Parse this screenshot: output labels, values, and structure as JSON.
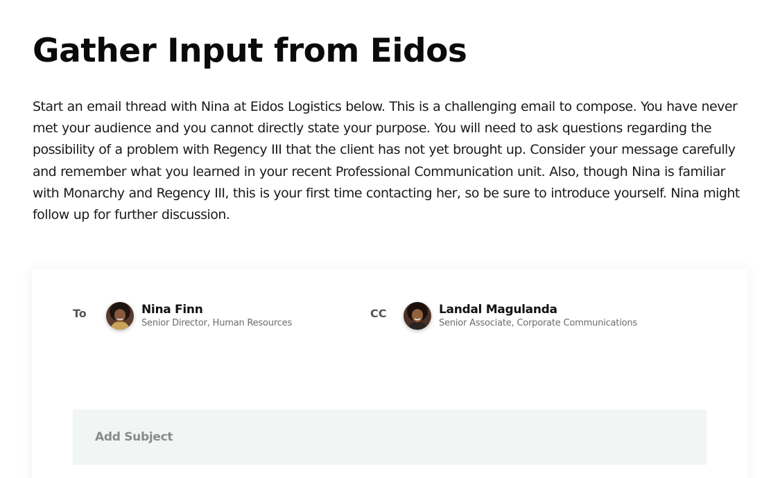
{
  "page": {
    "title": "Gather Input from Eidos",
    "intro": "Start an email thread with Nina at Eidos Logistics below. This is a challenging email to compose. You have never met your audience and you cannot directly state your purpose. You will need to ask questions regarding the possibility of a problem with Regency III that the client has not yet brought up. Consider your message carefully and remember what you learned in your recent Professional Communication unit. Also, though Nina is familiar with Monarchy and Regency III, this is your first time contacting her, so be sure to introduce yourself. Nina might follow up for further discussion."
  },
  "email": {
    "to": {
      "label": "To",
      "name": "Nina Finn",
      "role": "Senior Director, Human Resources"
    },
    "cc": {
      "label": "CC",
      "name": "Landal Magulanda",
      "role": "Senior Associate, Corporate Communications"
    },
    "subject": {
      "placeholder": "Add Subject"
    }
  },
  "colors": {
    "subject_bg": "#f1f6f4",
    "text": "#1a1a1a",
    "muted": "#6b6b6b"
  }
}
